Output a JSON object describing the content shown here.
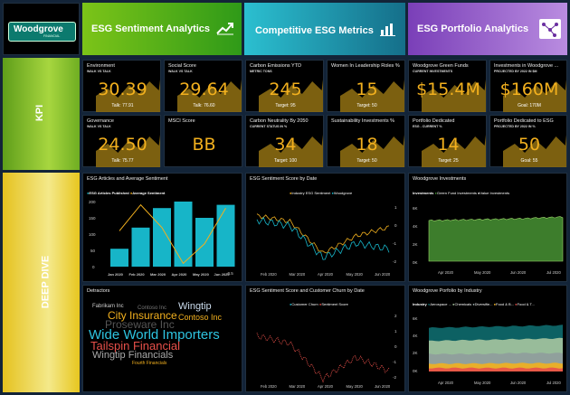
{
  "header": {
    "logo_text": "Woodgrove",
    "logo_sub": "FINANCIAL",
    "tab1": "ESG Sentiment Analytics",
    "tab2": "Competitive ESG Metrics",
    "tab3": "ESG Portfolio Analytics"
  },
  "sidebar": {
    "kpi": "KPI",
    "deep_dive": "DEEP DIVE"
  },
  "kpi": {
    "environment": {
      "title": "Environment",
      "sub": "WALK VS TALK",
      "value": "30.39",
      "note": "Talk: 77.91"
    },
    "social": {
      "title": "Social Score",
      "sub": "WALK VS TALK",
      "value": "29.64",
      "note": "Talk: 76.60"
    },
    "carbon": {
      "title": "Carbon Emissions YTD",
      "sub": "METRIC TONS",
      "value": "245",
      "note": "Target: 95"
    },
    "women": {
      "title": "Women In Leadership Roles %",
      "sub": "",
      "value": "15",
      "note": "Target: 50"
    },
    "green_funds": {
      "title": "Woodgrove Green Funds",
      "sub": "CURRENT INVESTMENTS",
      "value": "$15.4M",
      "note": ""
    },
    "investments": {
      "title": "Investments in Woodgrove ...",
      "sub": "PROJECTED BY 2022 IN $M",
      "value": "$160M",
      "note": "Goal: 170M"
    },
    "governance": {
      "title": "Governance",
      "sub": "WALK VS TALK",
      "value": "24.50",
      "note": "Talk: 75.77"
    },
    "msci": {
      "title": "MSCI Score",
      "sub": "",
      "value": "BB",
      "note": ""
    },
    "neutrality": {
      "title": "Carbon Neutrality By 2050",
      "sub": "CURRENT STATUS IN %",
      "value": "34",
      "note": "Target: 100"
    },
    "sustainability": {
      "title": "Sustainability Investments %",
      "sub": "",
      "value": "18",
      "note": "Target: 50"
    },
    "dedicated": {
      "title": "Portfolio Dedicated",
      "sub": "ESG - CURRENT %",
      "value": "14",
      "note": "Target: 25"
    },
    "dedicated_proj": {
      "title": "Portfolio Dedicated to ESG",
      "sub": "PROJECTED BY 2022 IN %",
      "value": "50",
      "note": "Goal: 55"
    }
  },
  "articles": {
    "title": "ESG Articles and Average Sentiment",
    "legend1": "ESG Articles Published",
    "legend2": "Average Sentiment",
    "y_left": [
      "200",
      "150",
      "100",
      "50",
      "0"
    ],
    "y_right": [
      "1.5",
      "1.0",
      "0.5",
      "0.0",
      "-0.5"
    ],
    "months": [
      "Jan 2020",
      "Feb 2020",
      "Mar 2020",
      "Apr 2020",
      "May 2020",
      "Jun 2020"
    ]
  },
  "sentiment": {
    "title": "ESG Sentiment Score by Date",
    "legend1": "Industry ESG Sentiment",
    "legend2": "Woodgrove",
    "y_right": [
      "1",
      "0",
      "-1",
      "-2"
    ],
    "months": [
      "Feb 2020",
      "Mar 2020",
      "Apr 2020",
      "May 2020",
      "Jun 2020"
    ]
  },
  "investments_chart": {
    "title": "Woodgrove Investments",
    "legend_label": "Investments",
    "legend1": "Green Fund Investments",
    "legend2": "Value Investments",
    "y": [
      "6K",
      "4K",
      "2K",
      "0K"
    ],
    "months": [
      "Apr 2020",
      "May 2020",
      "Jun 2020",
      "Jul 2020"
    ]
  },
  "detractors": {
    "title": "Detractors",
    "words": [
      "Fabrikam Inc",
      "Wingtip",
      "City Insurance",
      "Contoso Inc",
      "Contoso Inc",
      "Proseware Inc",
      "Wide World Importers",
      "Tailspin Financial",
      "Wingtip Financials",
      "Fourth Financials"
    ]
  },
  "churn": {
    "title": "ESG Sentiment Score and Customer Churn by Date",
    "legend1": "Customer Churn",
    "legend2": "Sentiment Score",
    "y_right": [
      "2",
      "1",
      "0",
      "-1",
      "-2"
    ],
    "months": [
      "Feb 2020",
      "Mar 2020",
      "Apr 2020",
      "May 2020",
      "Jun 2020"
    ]
  },
  "industry": {
    "title": "Woodgrove Porfolio by Industry",
    "legend_label": "Industry",
    "legend": [
      "Aerospace ...",
      "Chemicals",
      "Diversifie...",
      "Food & B...",
      "Food & T..."
    ],
    "y": [
      "6K",
      "4K",
      "2K",
      "0K"
    ],
    "months": [
      "Apr 2020",
      "May 2020",
      "Jun 2020",
      "Jul 2020"
    ]
  },
  "chart_data": [
    {
      "type": "bar",
      "title": "ESG Articles and Average Sentiment",
      "categories": [
        "Jan 2020",
        "Feb 2020",
        "Mar 2020",
        "Apr 2020",
        "May 2020",
        "Jun 2020"
      ],
      "series": [
        {
          "name": "ESG Articles Published",
          "values": [
            55,
            120,
            180,
            200,
            150,
            190
          ]
        },
        {
          "name": "Average Sentiment",
          "values": [
            0.6,
            1.4,
            0.7,
            -0.4,
            0.2,
            1.3
          ]
        }
      ],
      "ylim": [
        0,
        200
      ],
      "y2lim": [
        -0.5,
        1.5
      ]
    },
    {
      "type": "line",
      "title": "ESG Sentiment Score by Date",
      "x": [
        "Feb 2020",
        "Mar 2020",
        "Apr 2020",
        "May 2020",
        "Jun 2020"
      ],
      "series": [
        {
          "name": "Industry ESG Sentiment",
          "values": [
            0.9,
            0.5,
            -1.7,
            -0.5,
            0.1
          ]
        },
        {
          "name": "Woodgrove",
          "values": [
            0.6,
            0.2,
            -2.0,
            -1.0,
            -1.4
          ]
        }
      ],
      "ylim": [
        -2.5,
        1.5
      ]
    },
    {
      "type": "area",
      "title": "Woodgrove Investments",
      "x": [
        "Apr 2020",
        "May 2020",
        "Jun 2020",
        "Jul 2020"
      ],
      "series": [
        {
          "name": "Green Fund Investments",
          "values": [
            4500,
            4600,
            4700,
            4900
          ]
        },
        {
          "name": "Value Investments",
          "values": [
            0,
            0,
            0,
            0
          ]
        }
      ],
      "ylim": [
        0,
        6000
      ]
    },
    {
      "type": "line",
      "title": "ESG Sentiment Score and Customer Churn by Date",
      "x": [
        "Feb 2020",
        "Mar 2020",
        "Apr 2020",
        "May 2020",
        "Jun 2020"
      ],
      "series": [
        {
          "name": "Customer Churn",
          "values": [
            0.5,
            0.2,
            -1.0,
            0.0,
            0.4
          ]
        },
        {
          "name": "Sentiment Score",
          "values": [
            0.8,
            0.3,
            -2.0,
            -0.6,
            -1.5
          ]
        }
      ],
      "ylim": [
        -2,
        2
      ]
    },
    {
      "type": "area",
      "title": "Woodgrove Porfolio by Industry",
      "x": [
        "Apr 2020",
        "May 2020",
        "Jun 2020",
        "Jul 2020"
      ],
      "series": [
        {
          "name": "Aerospace ...",
          "values": [
            5000,
            5100,
            5200,
            5300
          ]
        },
        {
          "name": "Chemicals",
          "values": [
            3500,
            3600,
            3700,
            3800
          ]
        },
        {
          "name": "Diversifie...",
          "values": [
            2000,
            2000,
            2100,
            2100
          ]
        },
        {
          "name": "Food & B...",
          "values": [
            900,
            900,
            950,
            950
          ]
        },
        {
          "name": "Food & T...",
          "values": [
            400,
            400,
            400,
            400
          ]
        }
      ],
      "ylim": [
        0,
        6000
      ]
    }
  ],
  "colors": {
    "gold": "#f2b01e",
    "teal": "#17b5c8",
    "panel": "#000000"
  }
}
